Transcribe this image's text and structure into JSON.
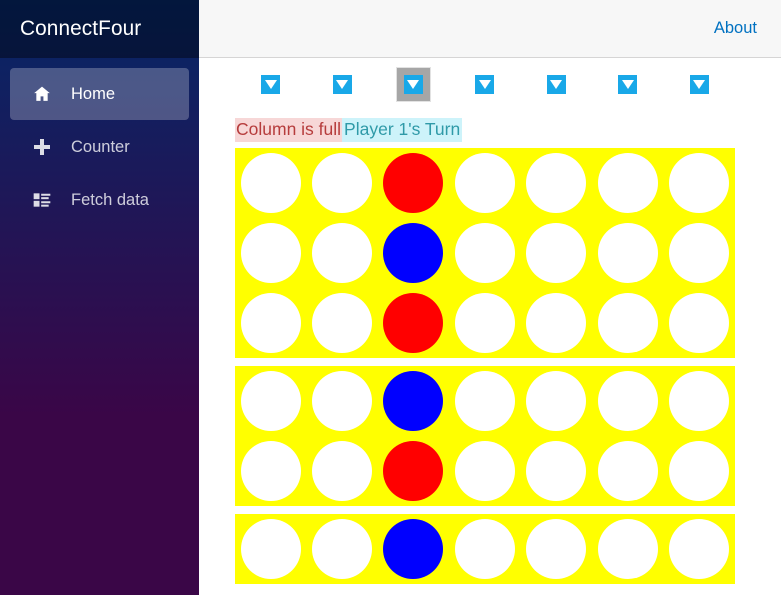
{
  "app": {
    "brand": "ConnectFour",
    "accent_blue": "#0071c1",
    "sidebar_gradient_from": "#052767",
    "sidebar_gradient_to": "#3a0647",
    "topbar_bg": "#f7f7f7"
  },
  "sidebar": {
    "items": [
      {
        "label": "Home",
        "icon": "home-icon",
        "active": true
      },
      {
        "label": "Counter",
        "icon": "plus-icon",
        "active": false
      },
      {
        "label": "Fetch data",
        "icon": "list-icon",
        "active": false
      }
    ]
  },
  "topbar": {
    "about_label": "About"
  },
  "game": {
    "columns": 7,
    "rows": 6,
    "drop_button_icon": "triangle-down-icon",
    "drop_buttons": [
      {
        "column": 1,
        "focused": false
      },
      {
        "column": 2,
        "focused": false
      },
      {
        "column": 3,
        "focused": true
      },
      {
        "column": 4,
        "focused": false
      },
      {
        "column": 5,
        "focused": false
      },
      {
        "column": 6,
        "focused": false
      },
      {
        "column": 7,
        "focused": false
      }
    ],
    "status": {
      "error_message": "Column is full",
      "error_text_color": "#b63c3c",
      "error_bg_color": "#f7d7d7",
      "turn_message": "Player 1's Turn",
      "turn_text_color": "#2f9aa8",
      "turn_bg_color": "#cdf3fa"
    },
    "board": {
      "board_color": "#ffff00",
      "empty_color": "#ffffff",
      "player1_color": "#ff0000",
      "player2_color": "#0000ff",
      "grid": [
        [
          "empty",
          "empty",
          "red",
          "empty",
          "empty",
          "empty",
          "empty"
        ],
        [
          "empty",
          "empty",
          "blue",
          "empty",
          "empty",
          "empty",
          "empty"
        ],
        [
          "empty",
          "empty",
          "red",
          "empty",
          "empty",
          "empty",
          "empty"
        ],
        [
          "empty",
          "empty",
          "blue",
          "empty",
          "empty",
          "empty",
          "empty"
        ],
        [
          "empty",
          "empty",
          "red",
          "empty",
          "empty",
          "empty",
          "empty"
        ],
        [
          "empty",
          "empty",
          "blue",
          "empty",
          "empty",
          "empty",
          "empty"
        ]
      ]
    }
  }
}
